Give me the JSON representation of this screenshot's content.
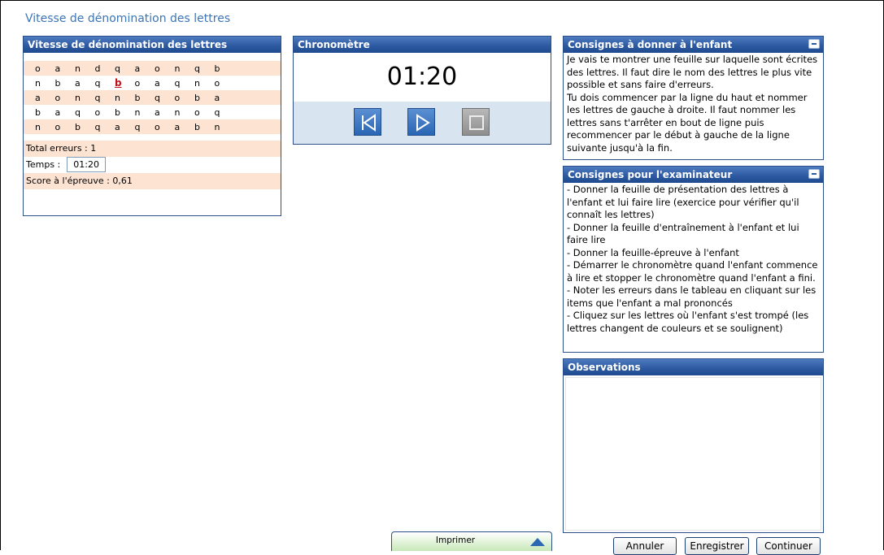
{
  "page_title": "Vitesse de dénomination des lettres",
  "letters_panel": {
    "title": "Vitesse de dénomination des lettres",
    "rows": [
      [
        "o",
        "a",
        "n",
        "d",
        "q",
        "a",
        "o",
        "n",
        "q",
        "b"
      ],
      [
        "n",
        "b",
        "a",
        "q",
        "b",
        "o",
        "a",
        "q",
        "n",
        "o"
      ],
      [
        "a",
        "o",
        "n",
        "q",
        "n",
        "b",
        "q",
        "o",
        "b",
        "a"
      ],
      [
        "b",
        "a",
        "q",
        "o",
        "b",
        "n",
        "a",
        "n",
        "o",
        "q"
      ],
      [
        "n",
        "o",
        "b",
        "q",
        "a",
        "q",
        "o",
        "a",
        "b",
        "n"
      ]
    ],
    "error_cells": [
      [
        1,
        4
      ]
    ],
    "total_errors": "Total erreurs : 1",
    "time_label": "Temps :",
    "time_value": "01:20",
    "score": "Score à l'épreuve : 0,61"
  },
  "chrono": {
    "title": "Chronomètre",
    "display": "01:20",
    "controls": [
      "reset-icon",
      "play-icon",
      "stop-icon"
    ]
  },
  "consignes_enfant": {
    "title": "Consignes à donner à l'enfant",
    "text": "Je vais te montrer une feuille sur laquelle sont écrites des lettres. Il faut dire le nom des lettres le plus vite possible et sans faire d'erreurs.\nTu dois commencer par la ligne du haut et nommer les lettres de gauche à droite. Il faut nommer les lettres sans t'arrêter en bout de ligne puis recommencer par le début à gauche de la ligne suivante jusqu'à la fin."
  },
  "consignes_exam": {
    "title": "Consignes pour l'examinateur",
    "text": "- Donner la feuille de présentation des lettres à l'enfant et lui faire lire (exercice pour vérifier qu'il connaît les lettres)\n- Donner la feuille d'entraînement à l'enfant et lui faire lire\n- Donner la feuille-épreuve à l'enfant\n- Démarrer le chronomètre quand l'enfant commence à lire et stopper le chronomètre quand l'enfant a fini.\n- Noter les erreurs dans le tableau en cliquant sur les items que l'enfant a mal prononcés\n- Cliquez sur les lettres où l'enfant s'est trompé (les lettres changent de couleurs et se soulignent)"
  },
  "observations": {
    "title": "Observations",
    "value": ""
  },
  "buttons": {
    "annuler": "Annuler",
    "enregistrer": "Enregistrer",
    "continuer": "Continuer"
  },
  "print_bar": {
    "label": "Imprimer"
  },
  "colors": {
    "header_blue": "#2d5aa1",
    "row_shade": "#fde3d2",
    "error_red": "#c0141c",
    "title_blue": "#3d75b5"
  }
}
